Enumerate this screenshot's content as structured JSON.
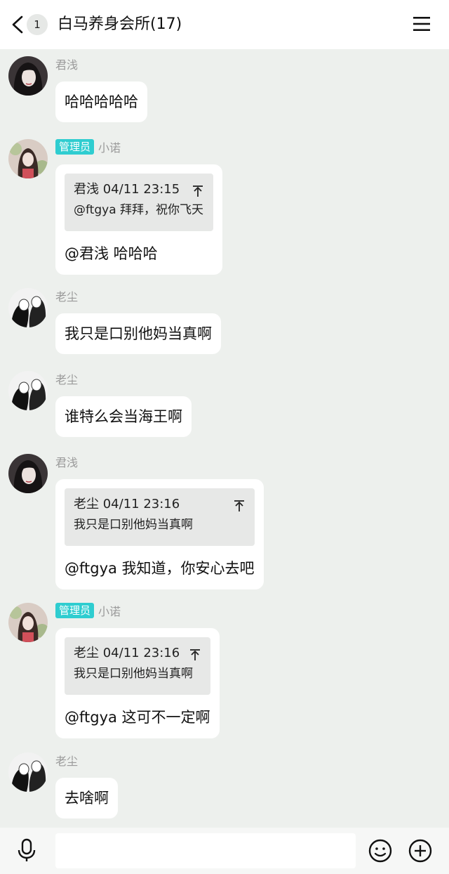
{
  "header": {
    "unread_count": "1",
    "title": "白马养身会所(17)",
    "back_icon": "chevron-left-icon",
    "menu_icon": "hamburger-menu-icon"
  },
  "messages": [
    {
      "sender": "君浅",
      "text": "哈哈哈哈哈"
    },
    {
      "role": "管理员",
      "sender": "小诺",
      "quote_head": "君浅 04/11 23:15",
      "quote_body": "@ftgya 拜拜，祝你飞天",
      "text": "@君浅 哈哈哈"
    },
    {
      "sender": "老尘",
      "text": "我只是口别他妈当真啊"
    },
    {
      "sender": "老尘",
      "text": "谁特么会当海王啊"
    },
    {
      "sender": "君浅",
      "quote_head": "老尘 04/11 23:16",
      "quote_body": "我只是口别他妈当真啊",
      "text": "@ftgya 我知道，你安心去吧"
    },
    {
      "role": "管理员",
      "sender": "小诺",
      "quote_head": "老尘 04/11 23:16",
      "quote_body": "我只是口别他妈当真啊",
      "text": "@ftgya 这可不一定啊"
    },
    {
      "sender": "老尘",
      "text": "去啥啊"
    }
  ],
  "input": {
    "value": "",
    "placeholder": ""
  },
  "icons": {
    "mic": "microphone-icon",
    "emoji": "emoji-icon",
    "plus": "plus-circle-icon",
    "quote_jump": "arrow-up-to-top-icon"
  },
  "colors": {
    "background": "#edf0ed",
    "bubble": "#ffffff",
    "admin_badge": "#2fcdd0",
    "quote_background": "#e7e8e7"
  }
}
